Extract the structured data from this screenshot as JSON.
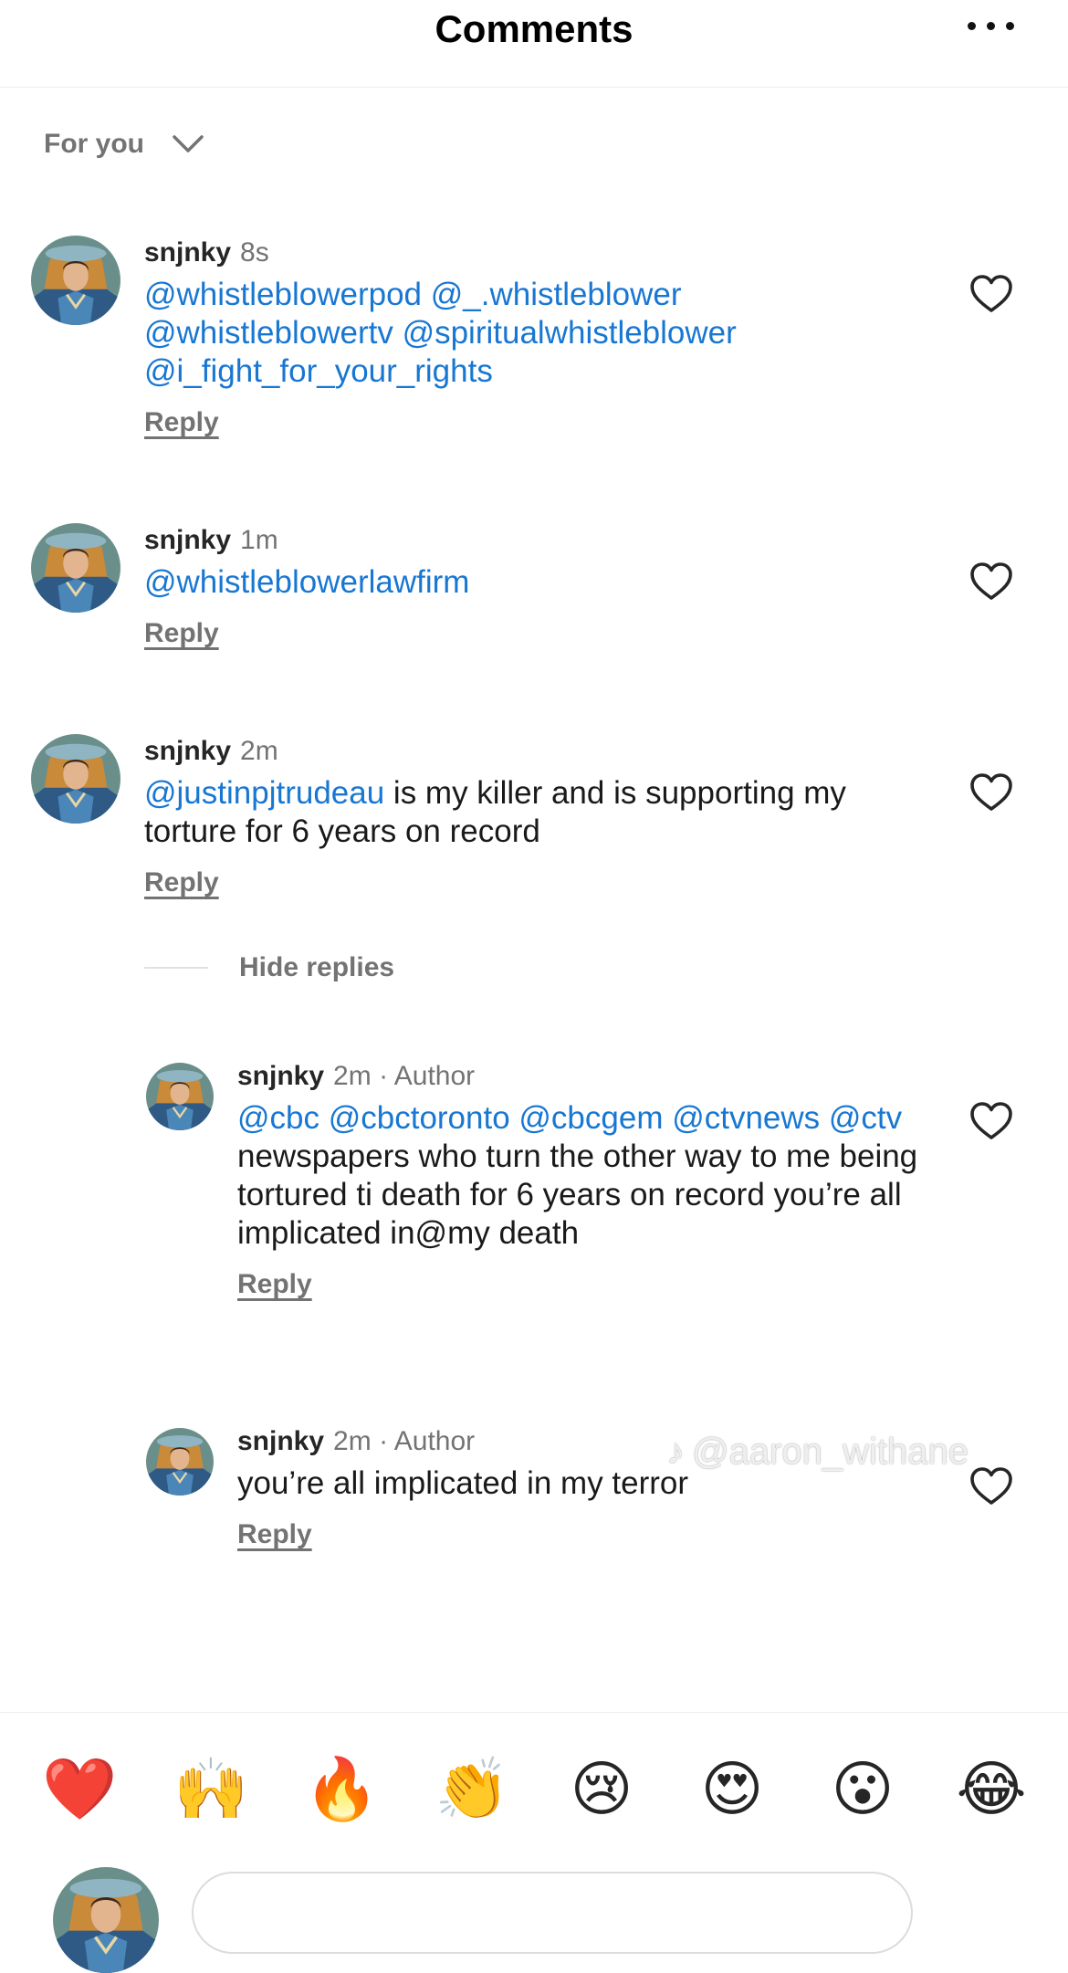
{
  "header": {
    "title": "Comments",
    "more_icon": "ellipsis-icon"
  },
  "filter": {
    "label": "For you",
    "icon": "chevron-down-icon"
  },
  "comments": [
    {
      "user": "snjnky",
      "time": "8s",
      "parts": [
        {
          "t": "@whistleblowerpod @_.whistleblower @whistleblowertv @spiritualwhistleblower @i_fight_for_your_rights",
          "m": true
        }
      ],
      "reply": "Reply"
    },
    {
      "user": "snjnky",
      "time": "1m",
      "parts": [
        {
          "t": "@whistleblowerlawfirm",
          "m": true
        }
      ],
      "reply": "Reply"
    },
    {
      "user": "snjnky",
      "time": "2m",
      "parts": [
        {
          "t": "@justinpjtrudeau",
          "m": true
        },
        {
          "t": " is my killer and is supporting my torture for 6 years on record",
          "m": false
        }
      ],
      "reply": "Reply"
    }
  ],
  "hide_replies": "Hide replies",
  "replies": [
    {
      "user": "snjnky",
      "time": "2m",
      "author": "· Author",
      "parts": [
        {
          "t": "@cbc @cbctoronto @cbcgem @ctvnews @ctv",
          "m": true
        },
        {
          "t": " newspapers who turn the other way to me being tortured ti death for 6 years on record you’re all implicated in@my death",
          "m": false
        }
      ],
      "reply": "Reply"
    },
    {
      "user": "snjnky",
      "time": "2m",
      "author": "· Author",
      "parts": [
        {
          "t": "you’re all implicated in my terror",
          "m": false
        }
      ],
      "reply": "Reply"
    }
  ],
  "watermark": {
    "logo": "♪",
    "handle": "@aaron_withane"
  },
  "emojis": [
    "❤️",
    "🙌",
    "🔥",
    "👏",
    "😢",
    "😍",
    "😮",
    "😂"
  ],
  "colors": {
    "mention": "#1877d2",
    "muted": "#737373",
    "heart_outline": "#262626"
  }
}
